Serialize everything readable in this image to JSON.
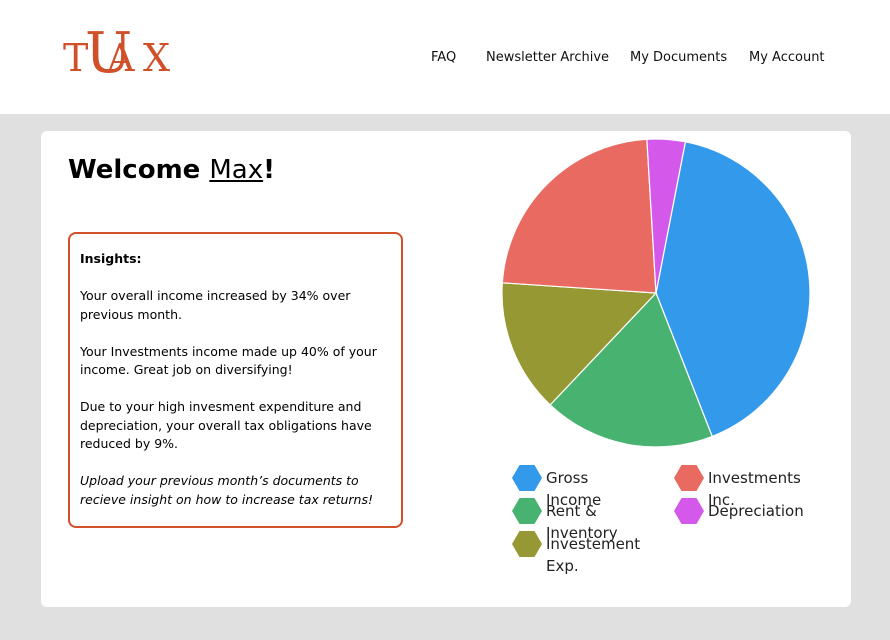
{
  "header": {
    "logo": {
      "t": "T",
      "u": "U",
      "a": "A",
      "x": "X"
    },
    "nav": [
      {
        "label": "FAQ"
      },
      {
        "label": "Newsletter Archive"
      },
      {
        "label": "My Documents"
      },
      {
        "label": "My Account"
      }
    ]
  },
  "welcome": {
    "greeting": "Welcome ",
    "name": "Max",
    "exclaim": "!"
  },
  "insights": {
    "title": "Insights:",
    "paragraphs": [
      "Your overall income increased by 34% over previous month.",
      "Your Investments income made up 40% of your income. Great job on diversifying!",
      "Due to your high invesment expenditure and depreciation, your overall tax obligations have reduced by 9%."
    ],
    "cta": "Upload your previous month’s documents to recieve insight on how to increase tax returns!"
  },
  "colors": {
    "brand": "#d0502a",
    "background": "#e0e0e0"
  },
  "chart_data": {
    "type": "pie",
    "slices": [
      {
        "label": "Gross Income",
        "value": 41,
        "color": "#3399ea"
      },
      {
        "label": "Rent & Inventory",
        "value": 18,
        "color": "#48b270"
      },
      {
        "label": "Investement Exp.",
        "value": 14,
        "color": "#969833"
      },
      {
        "label": "Investments Inc.",
        "value": 23,
        "color": "#e96a61"
      },
      {
        "label": "Depreciation",
        "value": 4,
        "color": "#d458ea"
      }
    ],
    "legend": [
      {
        "line1": "Gross Income",
        "line2": "",
        "color": "#3399ea"
      },
      {
        "line1": "Investments Inc.",
        "line2": "",
        "color": "#e96a61"
      },
      {
        "line1": "Rent & Inventory",
        "line2": "",
        "color": "#48b270"
      },
      {
        "line1": "Depreciation",
        "line2": "",
        "color": "#d458ea"
      },
      {
        "line1": "Investement",
        "line2": "Exp.",
        "color": "#969833"
      }
    ]
  }
}
